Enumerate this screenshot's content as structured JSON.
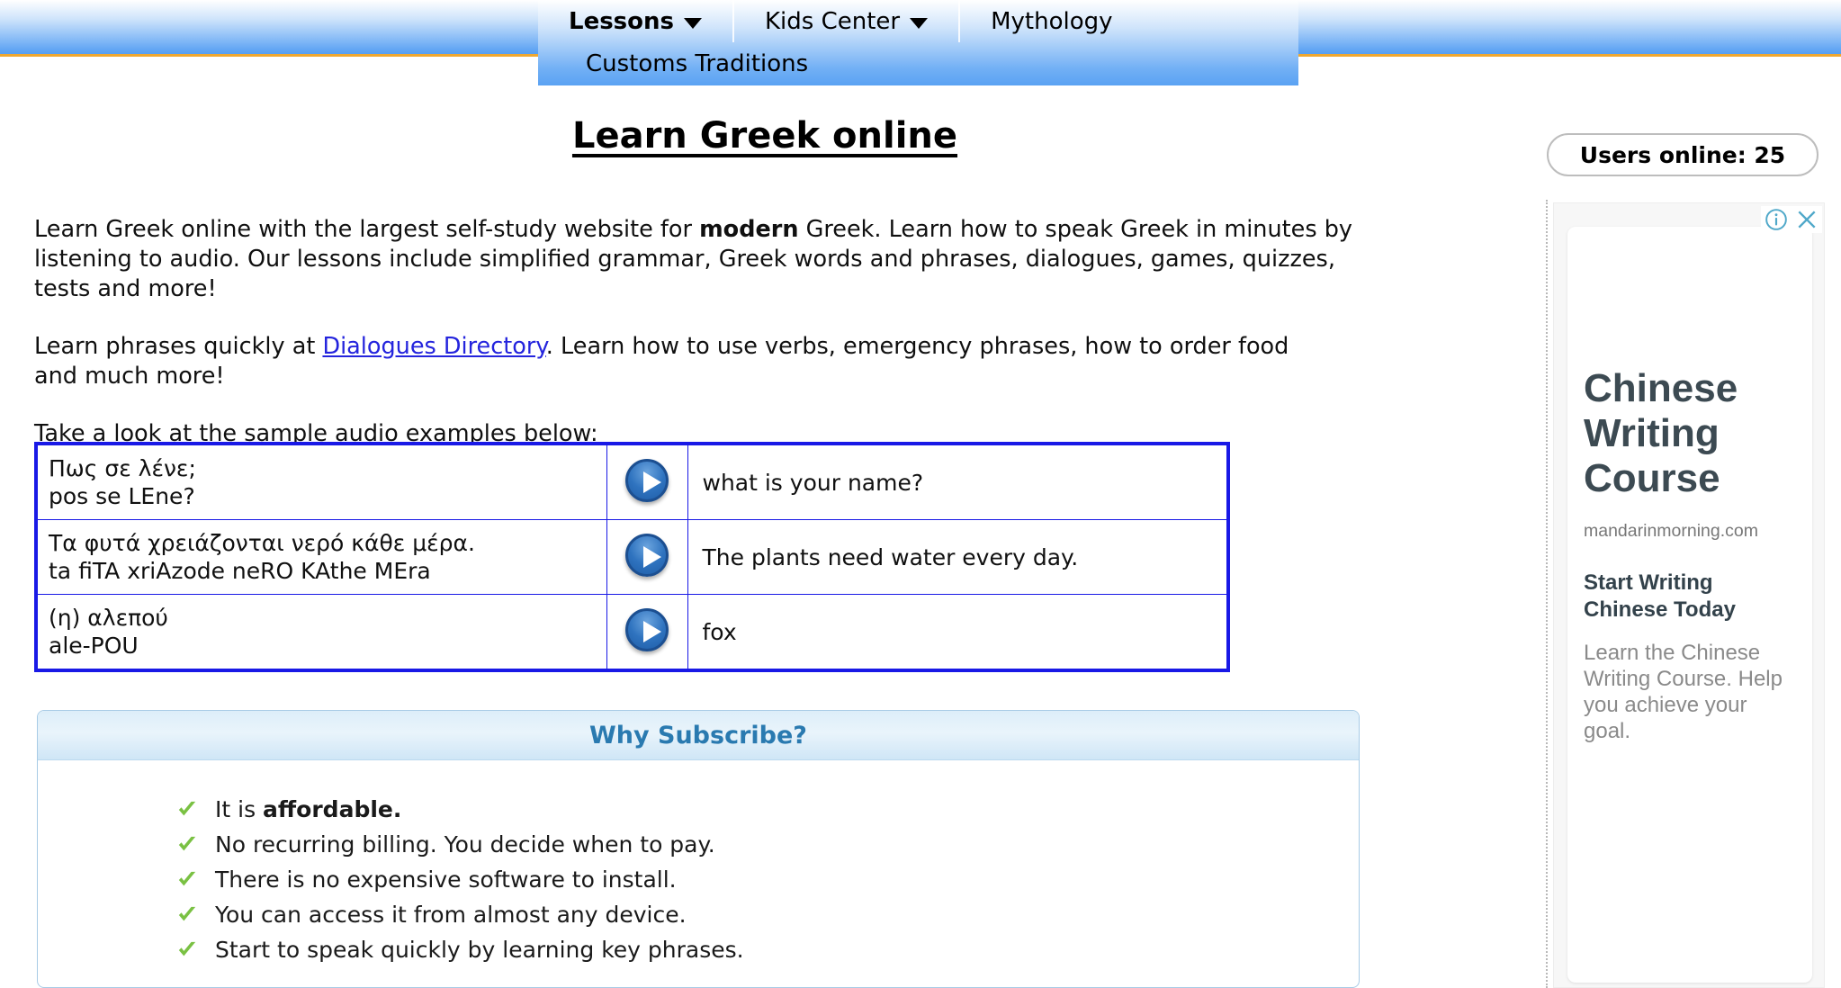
{
  "nav": {
    "items": [
      {
        "label": "Lessons",
        "has_caret": true,
        "bold": true
      },
      {
        "label": "Kids Center",
        "has_caret": true,
        "bold": false
      },
      {
        "label": "Mythology",
        "has_caret": false,
        "bold": false
      }
    ],
    "submenu": [
      {
        "label": "Customs Traditions"
      }
    ],
    "accent_color": "#f0a830",
    "bar_color": "#5aa2f3"
  },
  "page": {
    "title": "Learn Greek online",
    "paragraph1_pre": "Learn Greek online with the largest self-study website for ",
    "paragraph1_bold": "modern",
    "paragraph1_post": " Greek. Learn how to speak Greek in minutes by listening to audio. Our lessons include simplified grammar, Greek words and phrases, dialogues, games, quizzes, tests and more!",
    "paragraph2_pre": "Learn phrases quickly at ",
    "paragraph2_link": "Dialogues Directory",
    "paragraph2_post": ". Learn how to use verbs, emergency phrases, how to order food and much more!",
    "paragraph3": "Take a look at the sample audio examples below:",
    "link_color": "#2424dd"
  },
  "audio_table": {
    "border_color": "#1919e6",
    "play_icon": "play-icon",
    "rows": [
      {
        "greek": "Πως σε λένε;",
        "transliteration": "pos se LEne?",
        "english": "what is your name?"
      },
      {
        "greek": "Τα φυτά χρειάζονται νερό κάθε μέρα.",
        "transliteration": "ta fiTA xriAzode neRO KAthe MEra",
        "english": "The plants need water every day."
      },
      {
        "greek": "(η) αλεπού",
        "transliteration": "ale-POU",
        "english": "fox"
      }
    ]
  },
  "subscribe": {
    "heading": "Why Subscribe?",
    "heading_color": "#2a7ab0",
    "check_color": "#7ac143",
    "items": [
      {
        "pre": "It is ",
        "bold": "affordable.",
        "post": ""
      },
      {
        "pre": "No recurring billing. You decide when to pay.",
        "bold": "",
        "post": ""
      },
      {
        "pre": "There is no expensive software to install.",
        "bold": "",
        "post": ""
      },
      {
        "pre": "You can access it from almost any device.",
        "bold": "",
        "post": ""
      },
      {
        "pre": "Start to speak quickly by learning key phrases.",
        "bold": "",
        "post": ""
      }
    ]
  },
  "sidebar": {
    "users_online": "Users online: 25",
    "ad": {
      "info_icon": "info-circle-icon",
      "close_icon": "close-icon",
      "icon_color": "#4fa8c9",
      "headline": "Chinese Writing Course",
      "display_url": "mandarinmorning.com",
      "subheadline": "Start Writing Chinese Today",
      "body": "Learn the Chinese Writing Course. Help you achieve your goal."
    }
  }
}
